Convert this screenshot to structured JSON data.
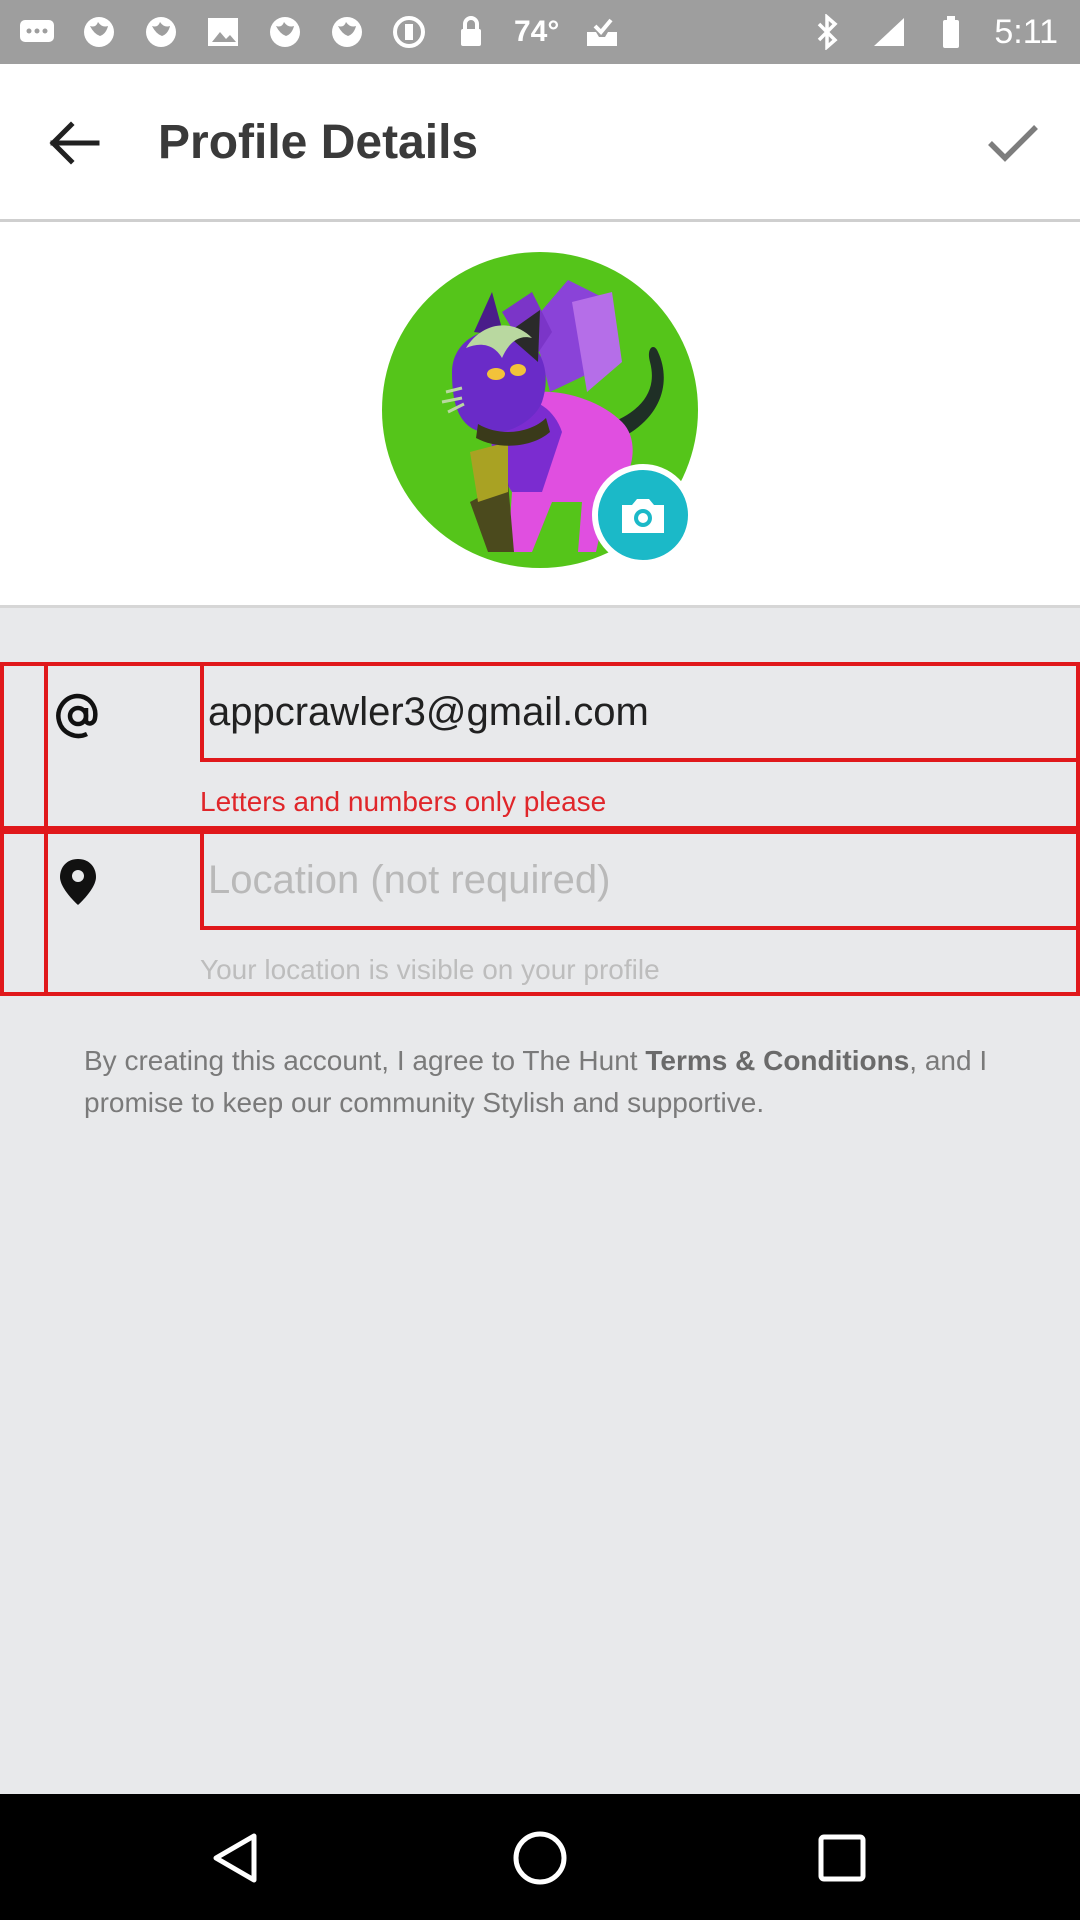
{
  "status_bar": {
    "temperature": "74°",
    "time": "5:11",
    "icons": [
      "messages-icon",
      "globe-icon",
      "globe-icon",
      "image-icon",
      "globe-icon",
      "globe-icon",
      "circle-icon",
      "lock-icon",
      "inbox-icon",
      "bluetooth-icon",
      "signal-icon",
      "battery-icon"
    ]
  },
  "app_bar": {
    "title": "Profile Details",
    "back_icon": "arrow-left-icon",
    "confirm_icon": "check-icon"
  },
  "avatar": {
    "camera_icon": "camera-icon",
    "accent": "#1bb9c8"
  },
  "email_field": {
    "icon": "at-icon",
    "value": "appcrawler3@gmail.com",
    "helper": "Letters and numbers only please"
  },
  "location_field": {
    "icon": "location-pin-icon",
    "placeholder": "Location (not required)",
    "helper": "Your location is visible on your profile"
  },
  "terms": {
    "prefix": "By creating this account, I agree to The Hunt ",
    "link": "Terms & Conditions",
    "suffix": ", and I promise to keep our community Stylish and supportive."
  },
  "colors": {
    "error": "#e0181b",
    "background": "#e8e9eb"
  },
  "nav_bar": {
    "icons": [
      "back-triangle-icon",
      "home-circle-icon",
      "recents-square-icon"
    ]
  }
}
